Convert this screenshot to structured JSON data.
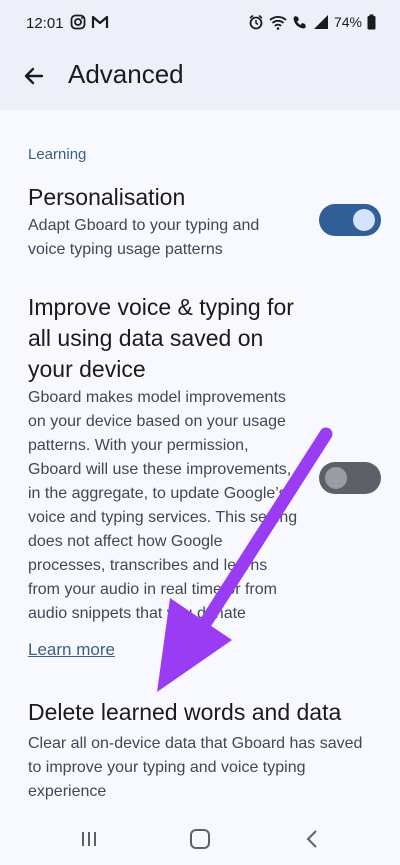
{
  "status_bar": {
    "time": "12:01",
    "battery": "74%",
    "left_icons": [
      "instagram-icon",
      "gmail-icon"
    ],
    "right_icons": [
      "alarm-icon",
      "wifi-icon",
      "wifi-call-icon",
      "signal-icon",
      "battery-icon"
    ]
  },
  "app_bar": {
    "title": "Advanced",
    "back_icon": "arrow-back-icon"
  },
  "section": {
    "header": "Learning"
  },
  "settings": [
    {
      "title": "Personalisation",
      "description": "Adapt Gboard to your typing and voice typing usage patterns",
      "toggle": "on"
    },
    {
      "title": "Improve voice & typing for all using data saved on your device",
      "description": "Gboard makes model improvements on your device based on your usage patterns. With your permission, Gboard will use these improvements, in the aggregate, to update Google’s voice and typing services. This setting does not affect how Google processes, transcribes and learns from your audio in real time or from audio snippets that you donate",
      "toggle": "off"
    },
    {
      "title": "Delete learned words and data",
      "description": "Clear all on-device data that Gboard has saved to improve your typing and voice typing experience"
    }
  ],
  "learn_more": "Learn more",
  "nav_bar": {
    "icons": [
      "recents-icon",
      "home-icon",
      "back-icon"
    ]
  },
  "colors": {
    "accent": "#2f5f96",
    "link": "#3a5f83",
    "annotation_arrow": "#9b3cf5"
  }
}
